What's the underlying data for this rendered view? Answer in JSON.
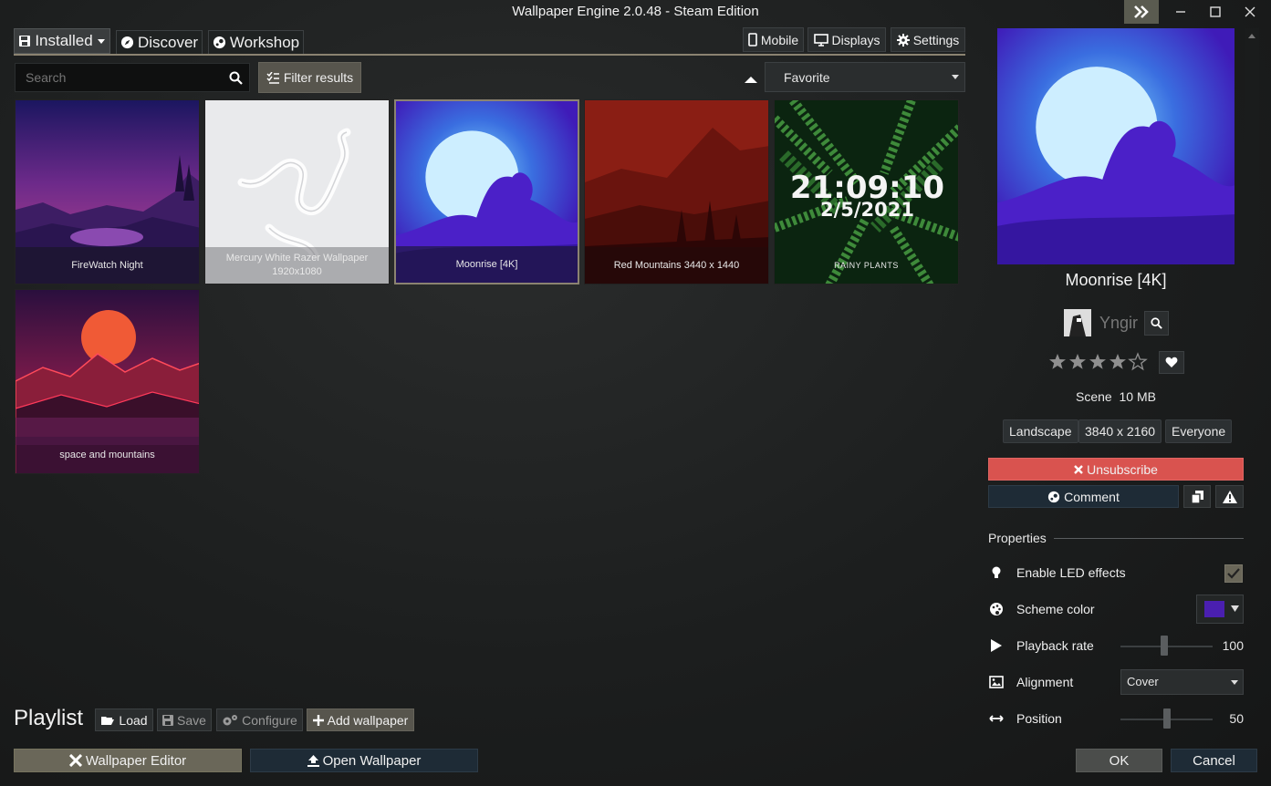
{
  "window": {
    "title": "Wallpaper Engine 2.0.48 - Steam Edition"
  },
  "tabs": {
    "installed": "Installed",
    "discover": "Discover",
    "workshop": "Workshop"
  },
  "top_buttons": {
    "mobile": "Mobile",
    "displays": "Displays",
    "settings": "Settings"
  },
  "search": {
    "placeholder": "Search"
  },
  "filter": {
    "label": "Filter results"
  },
  "sort": {
    "selected": "Favorite"
  },
  "wallpapers": [
    {
      "title": "FireWatch Night",
      "subtitle": ""
    },
    {
      "title": "Mercury White Razer Wallpaper",
      "subtitle": "1920x1080"
    },
    {
      "title": "Moonrise [4K]",
      "subtitle": ""
    },
    {
      "title": "Red Mountains 3440 x 1440",
      "subtitle": ""
    },
    {
      "title": "RAINY PLANTS",
      "subtitle": "",
      "clock_time": "21:09:10",
      "clock_date": "2/5/2021"
    },
    {
      "title": "space and mountains",
      "subtitle": ""
    }
  ],
  "playlist": {
    "title": "Playlist",
    "load": "Load",
    "save": "Save",
    "configure": "Configure",
    "add": "Add wallpaper"
  },
  "bottom": {
    "editor": "Wallpaper Editor",
    "open": "Open Wallpaper",
    "ok": "OK",
    "cancel": "Cancel"
  },
  "details": {
    "title": "Moonrise [4K]",
    "author": "Yngir",
    "rating": 4,
    "rating_max": 5,
    "type": "Scene",
    "size": "10 MB",
    "tags": [
      "Landscape",
      "3840 x 2160",
      "Everyone"
    ],
    "unsubscribe": "Unsubscribe",
    "comment": "Comment",
    "properties_header": "Properties",
    "properties": {
      "led": {
        "label": "Enable LED effects",
        "checked": true
      },
      "scheme": {
        "label": "Scheme color",
        "color": "#4a1fb0"
      },
      "playback": {
        "label": "Playback rate",
        "value": "100"
      },
      "alignment": {
        "label": "Alignment",
        "value": "Cover"
      },
      "position": {
        "label": "Position",
        "value": "50"
      }
    }
  },
  "colors": {
    "accent_red": "#d9534f",
    "selected_border": "#8b8371"
  }
}
